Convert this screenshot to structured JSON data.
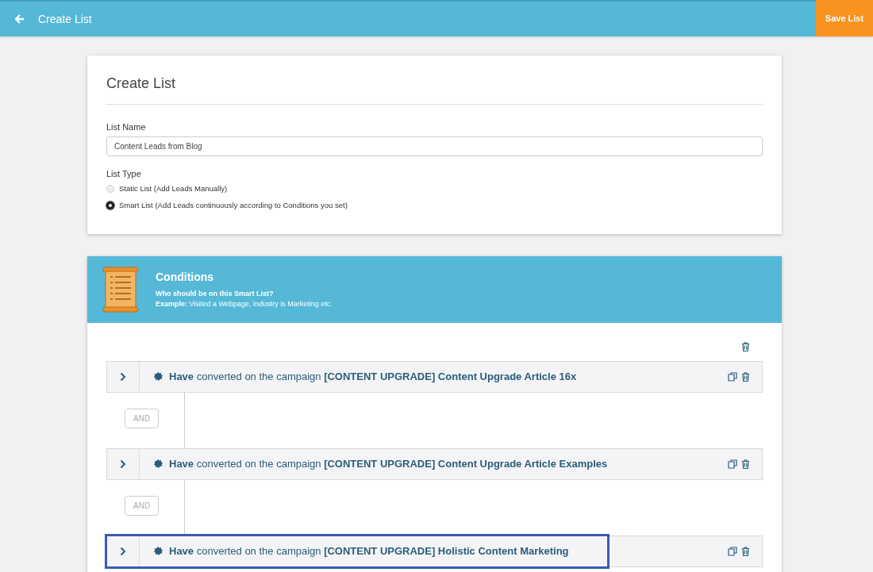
{
  "header": {
    "title": "Create List",
    "save_button": "Save List"
  },
  "form": {
    "title": "Create List",
    "list_name": {
      "label": "List Name",
      "value": "Content Leads from Blog"
    },
    "list_type": {
      "label": "List Type",
      "options": [
        {
          "label": "Static List (Add Leads Manually)",
          "selected": false
        },
        {
          "label": "Smart List (Add Leads continuously according to Conditions you set)",
          "selected": true
        }
      ]
    }
  },
  "conditions": {
    "title": "Conditions",
    "subtitle": "Who should be on this Smart List?",
    "example": "**Example:** Visited a Webpage, Industry is Marketing etc.",
    "items": [
      {
        "text": "**Have** converted on the campaign **[CONTENT UPGRADE] Content Upgrade Article 16x**",
        "highlighted": false
      },
      {
        "connector": "AND",
        "text": "**Have** converted on the campaign **[CONTENT UPGRADE] Content Upgrade Article Examples**",
        "highlighted": false
      },
      {
        "connector": "AND",
        "text": "**Have** converted on the campaign **[CONTENT UPGRADE] Holistic Content Marketing**",
        "highlighted": true
      }
    ]
  }
}
